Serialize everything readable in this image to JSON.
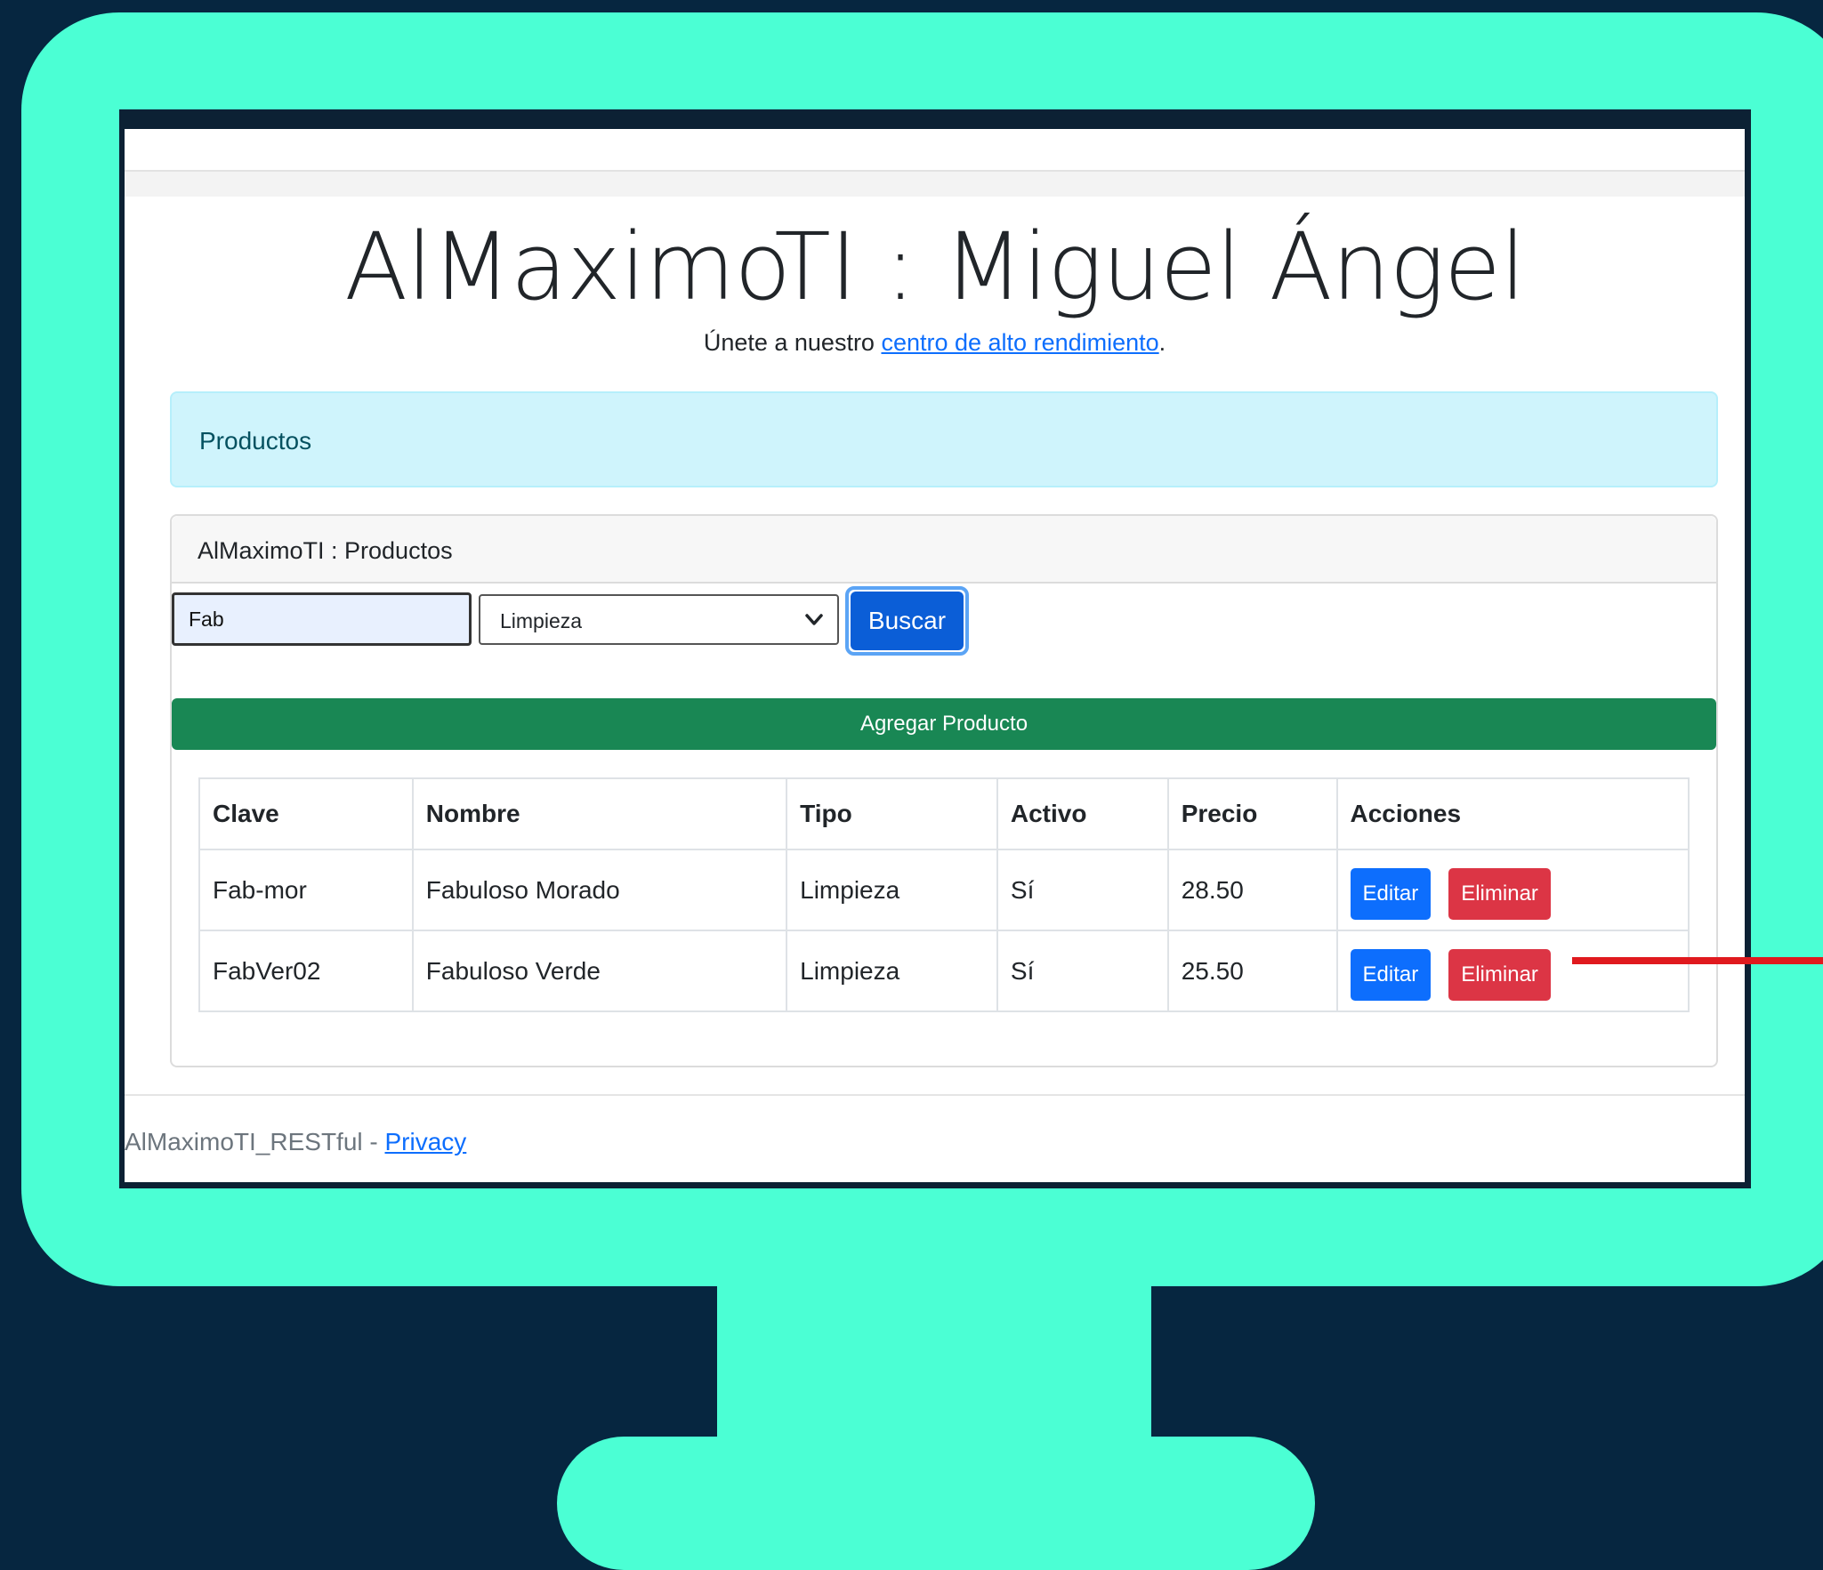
{
  "header": {
    "title": "AlMaximoTI : Miguel Ángel",
    "lead_prefix": "Únete a nuestro ",
    "lead_link": "centro de alto rendimiento",
    "lead_suffix": "."
  },
  "alert": {
    "text": "Productos"
  },
  "card": {
    "title": "AlMaximoTI : Productos",
    "search_value": "Fab",
    "type_selected": "Limpieza",
    "search_button": "Buscar",
    "add_button": "Agregar Producto"
  },
  "table": {
    "columns": [
      "Clave",
      "Nombre",
      "Tipo",
      "Activo",
      "Precio",
      "Acciones"
    ],
    "rows": [
      {
        "clave": "Fab-mor",
        "nombre": "Fabuloso Morado",
        "tipo": "Limpieza",
        "activo": "Sí",
        "precio": "28.50"
      },
      {
        "clave": "FabVer02",
        "nombre": "Fabuloso Verde",
        "tipo": "Limpieza",
        "activo": "Sí",
        "precio": "25.50"
      }
    ],
    "edit_label": "Editar",
    "delete_label": "Eliminar"
  },
  "footer": {
    "text": "AlMaximoTI_RESTful - ",
    "link": "Privacy"
  },
  "colors": {
    "monitor": "#4BFFD4",
    "background": "#062640",
    "primary": "#0d6efd",
    "success": "#198754",
    "danger": "#dc3545",
    "annotation": "#e0191e"
  }
}
